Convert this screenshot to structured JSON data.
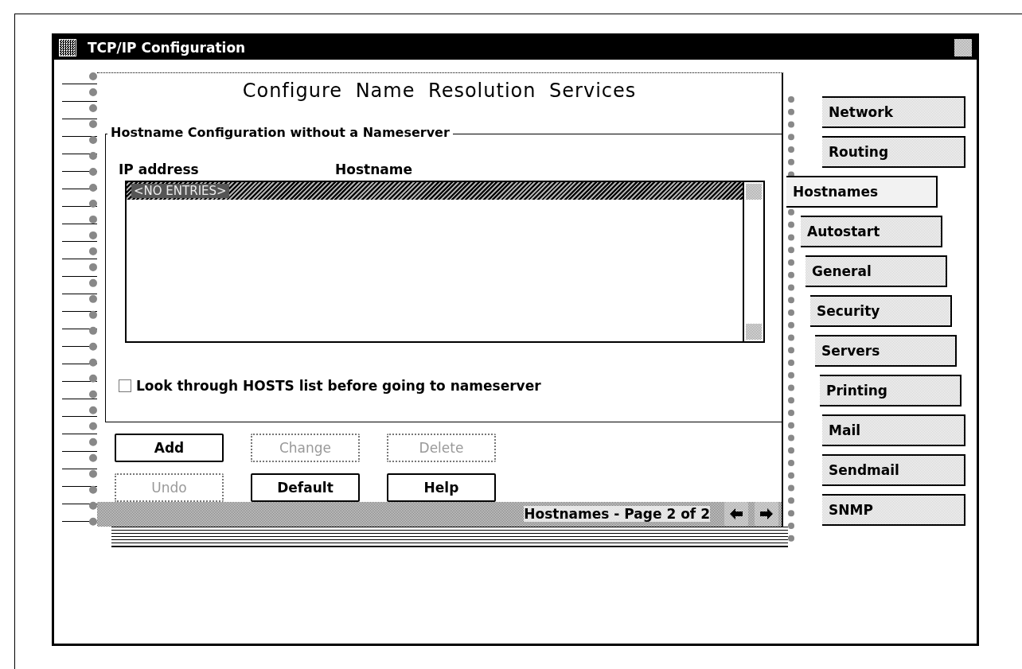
{
  "window": {
    "title": "TCP/IP Configuration"
  },
  "page": {
    "heading": "Configure Name Resolution Services",
    "group": {
      "title": "Hostname Configuration without a Nameserver",
      "columns": [
        "IP address",
        "Hostname"
      ],
      "rows": [
        {
          "text": "<NO ENTRIES>",
          "selected": true
        }
      ],
      "checkbox": {
        "label": "Look through HOSTS list before going to nameserver",
        "checked": false
      }
    },
    "buttons": [
      {
        "label": "Add",
        "disabled": false
      },
      {
        "label": "Change",
        "disabled": true
      },
      {
        "label": "Delete",
        "disabled": true
      },
      {
        "label": "Undo",
        "disabled": true
      },
      {
        "label": "Default",
        "disabled": false
      },
      {
        "label": "Help",
        "disabled": false
      }
    ],
    "status": "Hostnames - Page 2 of 2"
  },
  "tabs": [
    {
      "label": "Network",
      "selected": false
    },
    {
      "label": "Routing",
      "selected": false
    },
    {
      "label": "Hostnames",
      "selected": true
    },
    {
      "label": "Autostart",
      "selected": false
    },
    {
      "label": "General",
      "selected": false
    },
    {
      "label": "Security",
      "selected": false
    },
    {
      "label": "Servers",
      "selected": false
    },
    {
      "label": "Printing",
      "selected": false
    },
    {
      "label": "Mail",
      "selected": false
    },
    {
      "label": "Sendmail",
      "selected": false
    },
    {
      "label": "SNMP",
      "selected": false
    }
  ]
}
